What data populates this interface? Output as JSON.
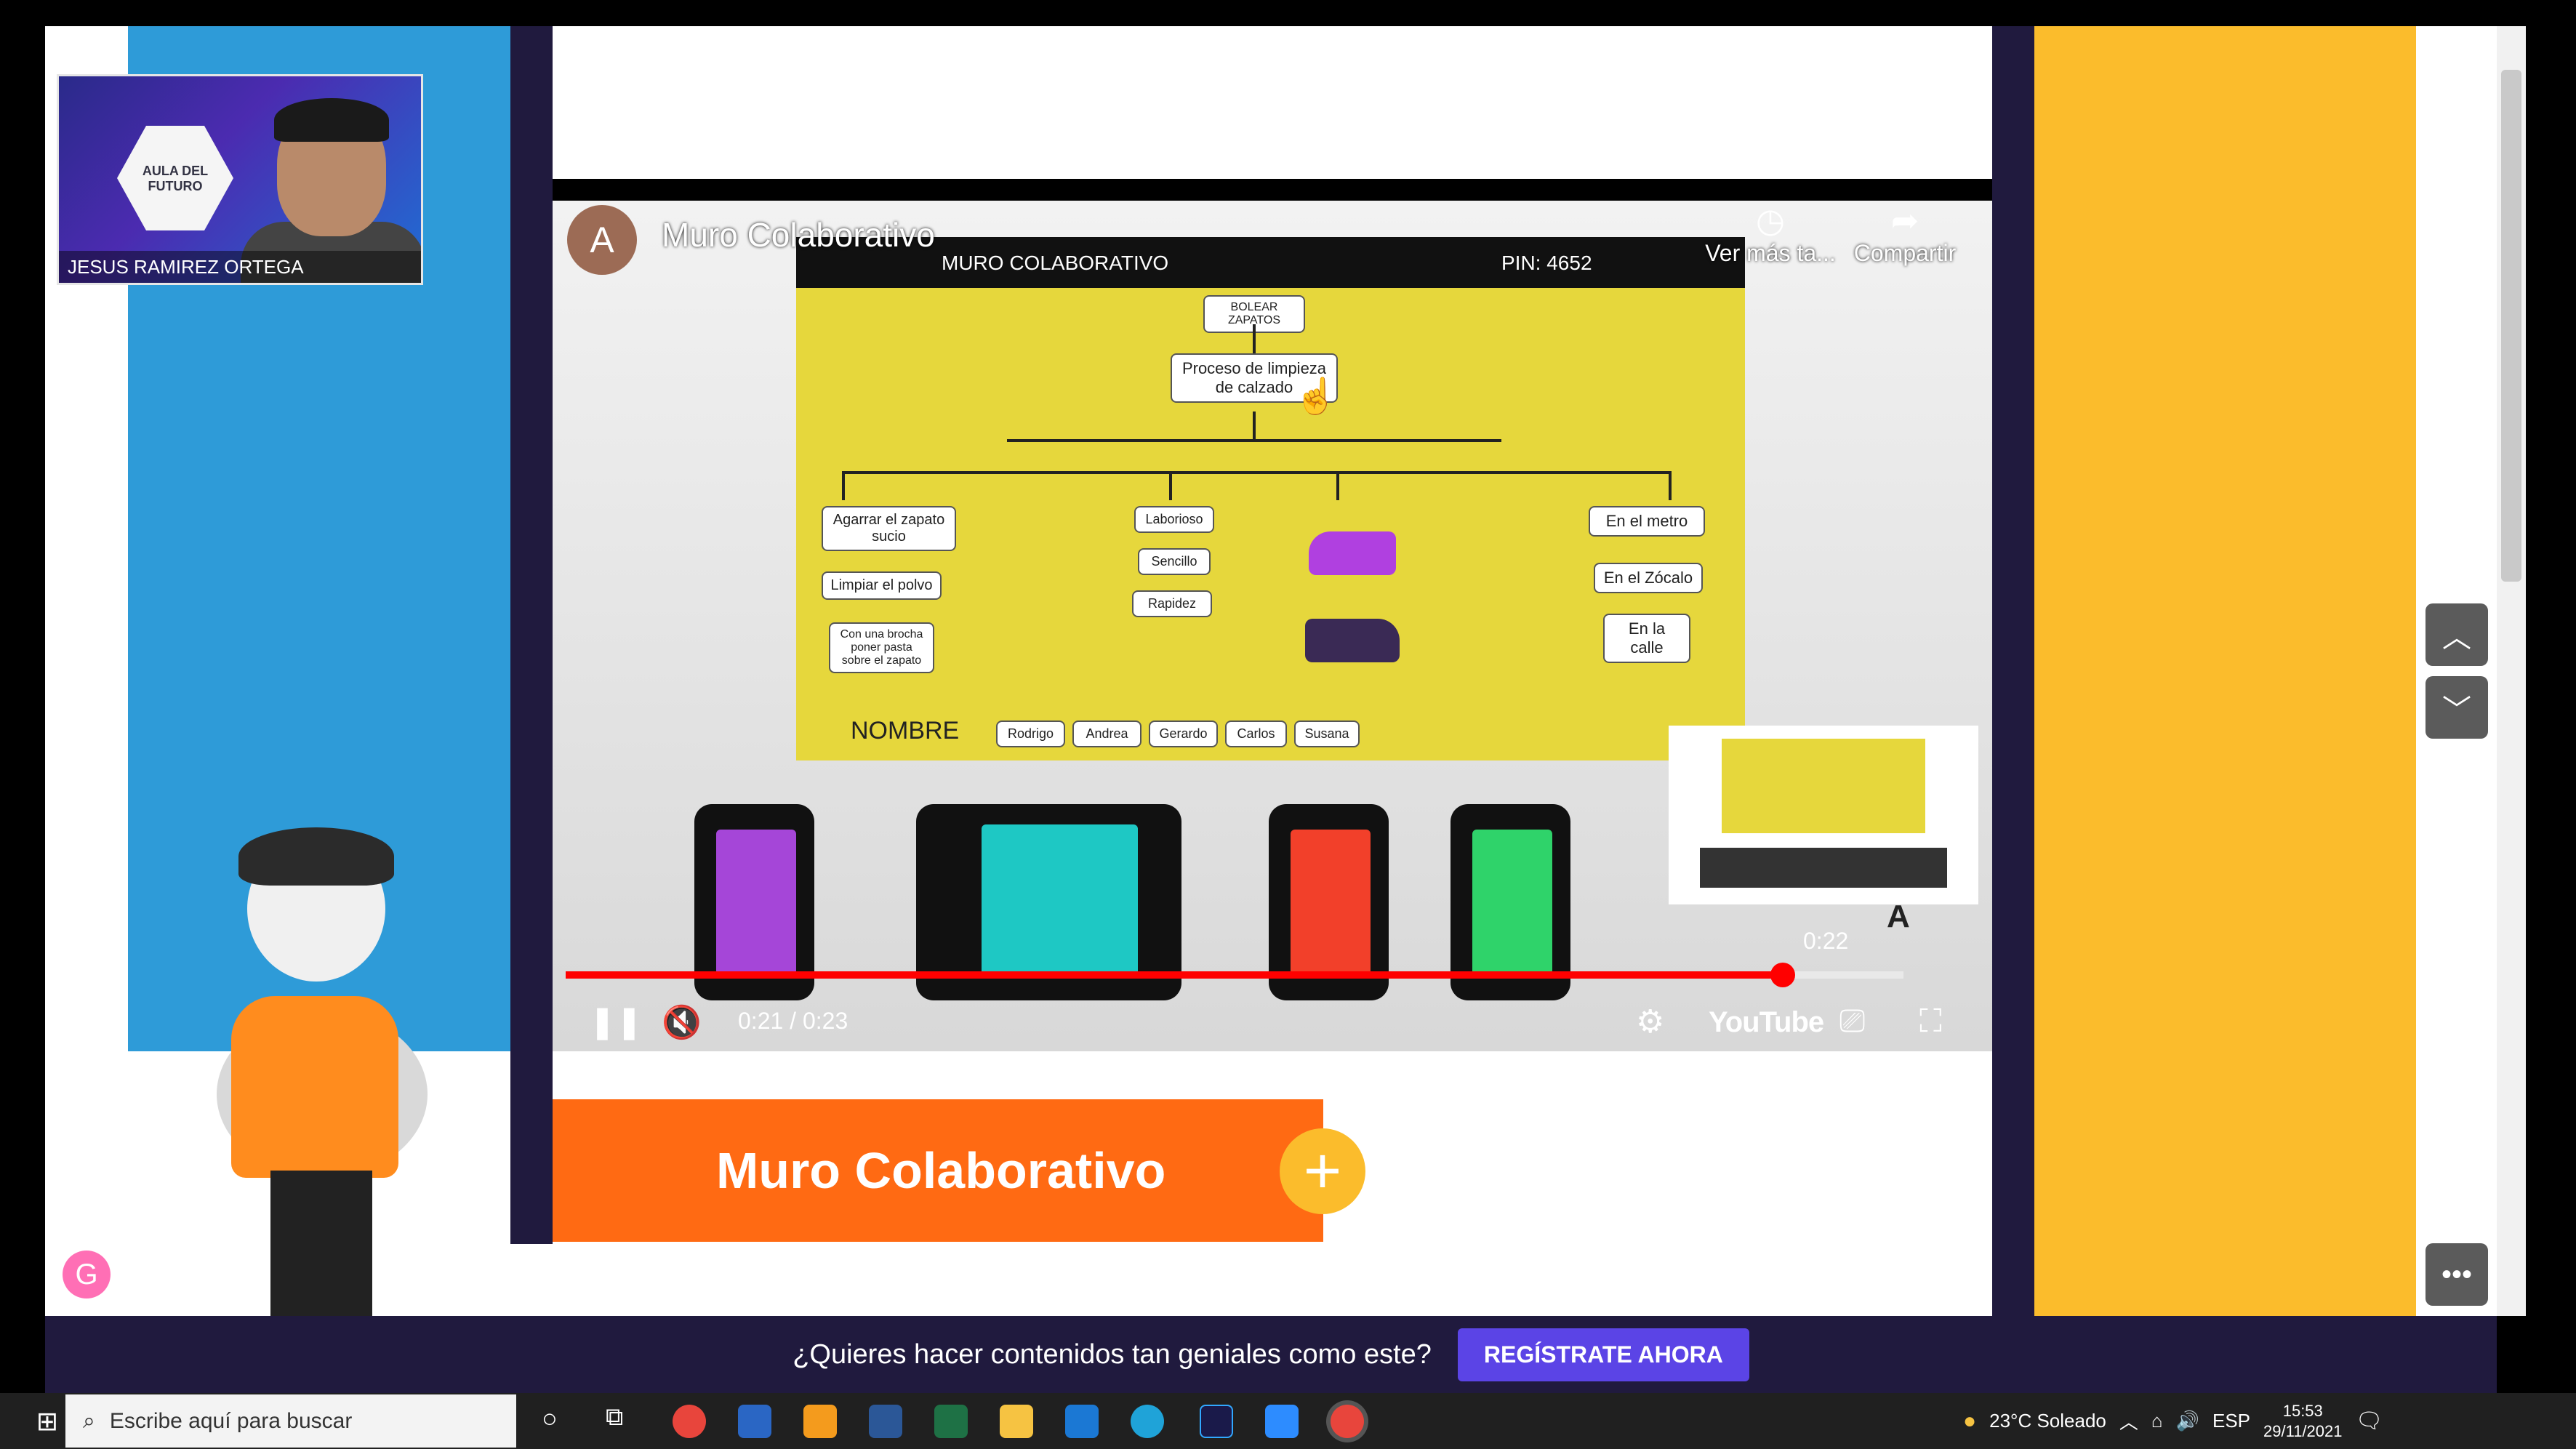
{
  "webcam": {
    "name": "JESUS RAMIREZ ORTEGA",
    "logo_text": "AULA DEL FUTURO"
  },
  "video": {
    "channel_initial": "A",
    "title": "Muro Colaborativo",
    "watch_later_label": "Ver más ta...",
    "share_label": "Compartir",
    "time_current": "0:21",
    "time_total": "0:23",
    "hover_time": "0:22",
    "progress_fraction": 0.91,
    "youtube_label": "YouTube",
    "slide": {
      "header": "MURO COLABORATIVO",
      "pin": "PIN: 4652",
      "root": "BOLEAR ZAPATOS",
      "main": "Proceso de limpieza de calzado",
      "col1": [
        "Agarrar el zapato sucio",
        "Limpiar el polvo",
        "Con una brocha poner pasta sobre el zapato"
      ],
      "col2": [
        "Laborioso",
        "Sencillo",
        "Rapidez"
      ],
      "col4": [
        "En el metro",
        "En el Zócalo",
        "En la calle"
      ],
      "nombre_label": "NOMBRE",
      "names": [
        "Rodrigo",
        "Andrea",
        "Gerardo",
        "Carlos",
        "Susana"
      ]
    }
  },
  "banner": {
    "title": "Muro Colaborativo"
  },
  "register": {
    "text": "¿Quieres hacer contenidos tan geniales como este?",
    "button": "REGÍSTRATE AHORA"
  },
  "taskbar": {
    "search_placeholder": "Escribe aquí para buscar",
    "weather": "23°C  Soleado",
    "lang": "ESP",
    "time": "15:53",
    "date": "29/11/2021"
  },
  "colors": {
    "orange": "#ff6a13",
    "yellow": "#fbbc2c",
    "blue": "#2e9bd8",
    "navy": "#201a3e",
    "register_button": "#5b44e6"
  }
}
